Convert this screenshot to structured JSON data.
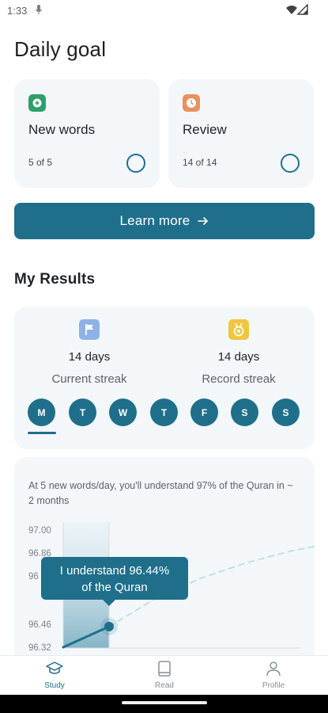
{
  "status_bar": {
    "time": "1:33"
  },
  "page": {
    "title": "Daily goal"
  },
  "goals": [
    {
      "title": "New words",
      "count": "5 of 5",
      "icon": "plus-circle-icon",
      "color": "#2e9e6a"
    },
    {
      "title": "Review",
      "count": "14 of 14",
      "icon": "clock-icon",
      "color": "#e8925c"
    }
  ],
  "learn_more": {
    "label": "Learn more"
  },
  "results": {
    "title": "My Results",
    "current_streak": {
      "days": "14 days",
      "label": "Current streak",
      "icon": "flag-icon",
      "color": "#8fb2e6"
    },
    "record_streak": {
      "days": "14 days",
      "label": "Record streak",
      "icon": "medal-icon",
      "color": "#f0c63e"
    },
    "days": [
      "M",
      "T",
      "W",
      "T",
      "F",
      "S",
      "S"
    ]
  },
  "projection": {
    "text": "At 5 new words/day, you'll understand 97% of the Quran in ~ 2 months",
    "tooltip_line1": "I understand 96.44%",
    "tooltip_line2": "of the Quran"
  },
  "chart_data": {
    "type": "line",
    "y_ticks": [
      "97.00",
      "96.86",
      "96",
      "96.46",
      "96.32"
    ],
    "ylim": [
      96.32,
      97.0
    ],
    "series": [
      {
        "style": "solid",
        "x": [
          0,
          1
        ],
        "y": [
          96.32,
          96.44
        ]
      },
      {
        "style": "dashed",
        "x": [
          1,
          2,
          3,
          4,
          5,
          6,
          7
        ],
        "y": [
          96.44,
          96.6,
          96.72,
          96.81,
          96.88,
          96.93,
          96.97
        ]
      }
    ],
    "highlight": {
      "x": 1,
      "y": 96.44
    }
  },
  "nav": [
    {
      "label": "Study",
      "icon": "graduation-cap-icon",
      "active": true
    },
    {
      "label": "Read",
      "icon": "book-icon",
      "active": false
    },
    {
      "label": "Profile",
      "icon": "person-icon",
      "active": false
    }
  ],
  "colors": {
    "primary": "#1f6f8b",
    "card_bg": "#f3f7f9",
    "chart_line": "#1f6f8b",
    "chart_dash": "#bfe0ea"
  }
}
